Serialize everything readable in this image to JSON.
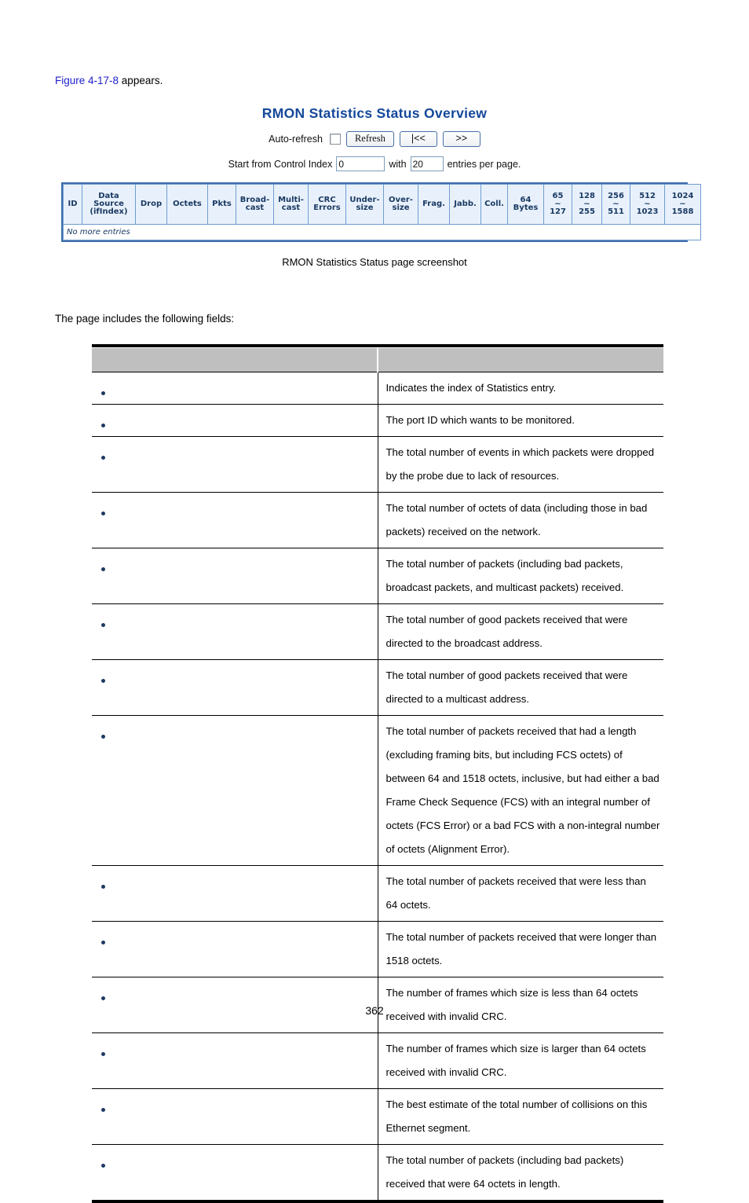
{
  "document": {
    "intro_prefix": "Figure 4-17-8",
    "intro_suffix": " appears.",
    "caption": "RMON Statistics Status page screenshot",
    "leadin": "The page includes the following fields:",
    "page_number": "362"
  },
  "screenshot": {
    "title": "RMON Statistics Status Overview",
    "auto_refresh_label": "Auto-refresh",
    "refresh_button": "Refresh",
    "prev_button": "|<<",
    "next_button": ">>",
    "start_label": "Start from Control Index",
    "start_value": "0",
    "with_label": "with",
    "entries_value": "20",
    "entries_suffix": "entries per page.",
    "no_more_entries": "No more entries",
    "columns": [
      {
        "line1": "ID",
        "line2": "",
        "line3": ""
      },
      {
        "line1": "Data",
        "line2": "Source",
        "line3": "(ifIndex)"
      },
      {
        "line1": "Drop",
        "line2": "",
        "line3": ""
      },
      {
        "line1": "Octets",
        "line2": "",
        "line3": ""
      },
      {
        "line1": "Pkts",
        "line2": "",
        "line3": ""
      },
      {
        "line1": "Broad-",
        "line2": "cast",
        "line3": ""
      },
      {
        "line1": "Multi-",
        "line2": "cast",
        "line3": ""
      },
      {
        "line1": "CRC",
        "line2": "Errors",
        "line3": ""
      },
      {
        "line1": "Under-",
        "line2": "size",
        "line3": ""
      },
      {
        "line1": "Over-",
        "line2": "size",
        "line3": ""
      },
      {
        "line1": "Frag.",
        "line2": "",
        "line3": ""
      },
      {
        "line1": "Jabb.",
        "line2": "",
        "line3": ""
      },
      {
        "line1": "Coll.",
        "line2": "",
        "line3": ""
      },
      {
        "line1": "64",
        "line2": "Bytes",
        "line3": ""
      },
      {
        "line1": "65",
        "line2": "~",
        "line3": "127"
      },
      {
        "line1": "128",
        "line2": "~",
        "line3": "255"
      },
      {
        "line1": "256",
        "line2": "~",
        "line3": "511"
      },
      {
        "line1": "512",
        "line2": "~",
        "line3": "1023"
      },
      {
        "line1": "1024",
        "line2": "~",
        "line3": "1588"
      }
    ],
    "colors": {
      "title": "#14489b",
      "header_bg": "#e8f1fb",
      "border": "#3f6eab"
    }
  },
  "fields_table": {
    "header": {
      "col1": "",
      "col2": ""
    },
    "rows": [
      {
        "name": "",
        "description": "Indicates the index of Statistics entry."
      },
      {
        "name": "",
        "description": "The port ID which wants to be monitored."
      },
      {
        "name": "",
        "description": "The total number of events in which packets were dropped by the probe due to lack of resources."
      },
      {
        "name": "",
        "description": "The total number of octets of data (including those in bad packets) received on the network."
      },
      {
        "name": "",
        "description": "The total number of packets (including bad packets, broadcast packets, and multicast packets) received."
      },
      {
        "name": "",
        "description": "The total number of good packets received that were directed to the broadcast address."
      },
      {
        "name": "",
        "description": "The total number of good packets received that were directed to a multicast address."
      },
      {
        "name": "",
        "description": "The total number of packets received that had a length (excluding framing bits, but including FCS octets) of between 64 and 1518 octets, inclusive, but had either a bad Frame Check Sequence (FCS) with an integral number of octets (FCS Error) or a bad FCS with a non-integral number of octets (Alignment Error)."
      },
      {
        "name": "",
        "description": "The total number of packets received that were less than 64 octets."
      },
      {
        "name": "",
        "description": "The total number of packets received that were longer than 1518 octets."
      },
      {
        "name": "",
        "description": "The number of frames which size is less than 64 octets received with invalid CRC."
      },
      {
        "name": "",
        "description": "The number of frames which size is larger than 64 octets received with invalid CRC."
      },
      {
        "name": "",
        "description": "The best estimate of the total number of collisions on this Ethernet segment."
      },
      {
        "name": "",
        "description": "The total number of packets (including bad packets) received that were 64 octets in length."
      }
    ]
  }
}
